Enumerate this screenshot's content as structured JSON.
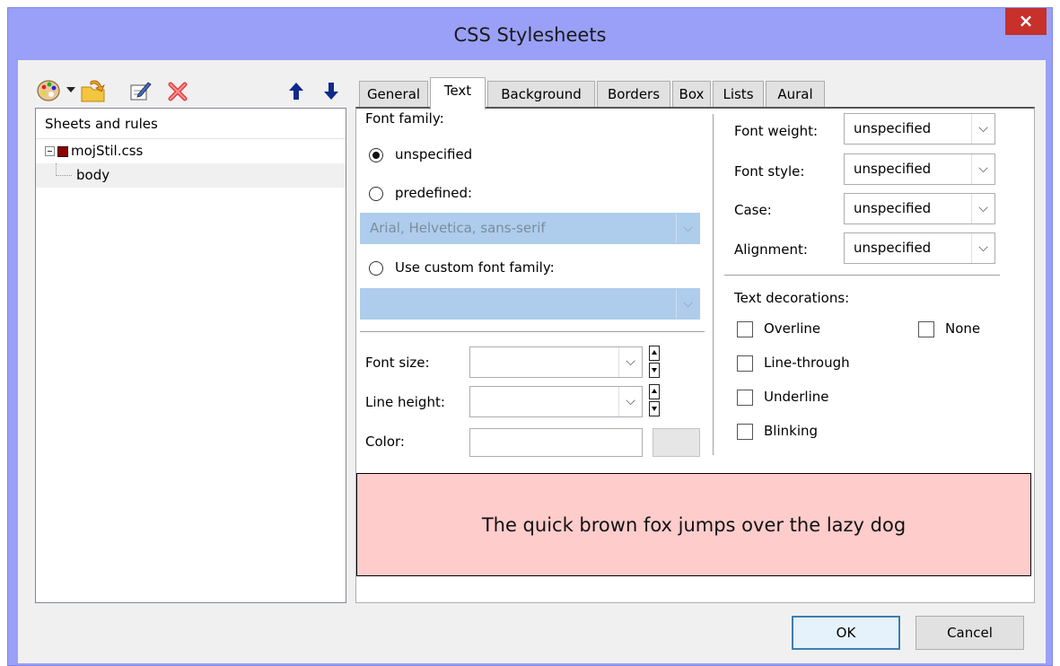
{
  "window": {
    "title": "CSS Stylesheets",
    "close_label": "×"
  },
  "toolbar": {
    "icons": [
      "palette-icon",
      "dropdown-arrow-icon",
      "open-file-icon",
      "edit-icon",
      "delete-icon",
      "arrow-up-icon",
      "arrow-down-icon"
    ]
  },
  "tree": {
    "header": "Sheets and rules",
    "sheet": "mojStil.css",
    "rule": "body"
  },
  "tabs": [
    "General",
    "Text",
    "Background",
    "Borders",
    "Box",
    "Lists",
    "Aural"
  ],
  "active_tab": "Text",
  "text_tab": {
    "font_family_label": "Font family:",
    "radio_unspecified": "unspecified",
    "radio_predefined": "predefined:",
    "predefined_value": "Arial, Helvetica, sans-serif",
    "radio_custom": "Use custom font family:",
    "custom_value": "",
    "font_size_label": "Font size:",
    "font_size_value": "",
    "line_height_label": "Line height:",
    "line_height_value": "",
    "color_label": "Color:",
    "color_value": "",
    "font_weight_label": "Font weight:",
    "font_weight_value": "unspecified",
    "font_style_label": "Font style:",
    "font_style_value": "unspecified",
    "case_label": "Case:",
    "case_value": "unspecified",
    "alignment_label": "Alignment:",
    "alignment_value": "unspecified",
    "decorations_label": "Text decorations:",
    "overline": "Overline",
    "none": "None",
    "line_through": "Line-through",
    "underline": "Underline",
    "blinking": "Blinking"
  },
  "preview": {
    "text": "The quick brown fox jumps over the lazy dog",
    "background": "#ffcccc"
  },
  "buttons": {
    "ok": "OK",
    "cancel": "Cancel"
  },
  "colors": {
    "titlebar": "#9aa0f7",
    "close": "#c7302b",
    "disabled_combo": "#aecdec"
  }
}
